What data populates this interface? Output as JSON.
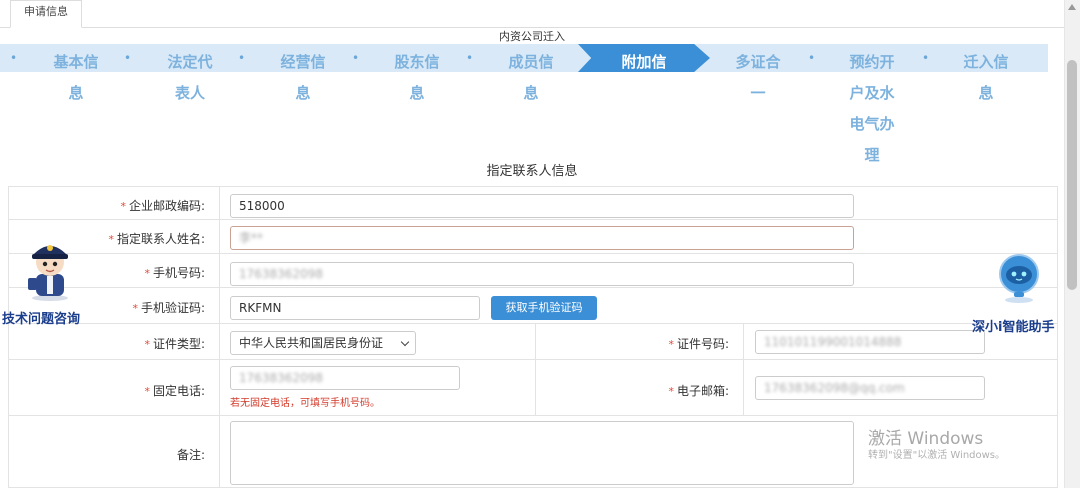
{
  "tab": {
    "label": "申请信息"
  },
  "wizard": {
    "title": "内资公司迁入",
    "steps": [
      {
        "lines": [
          "基本信",
          "息"
        ]
      },
      {
        "lines": [
          "法定代",
          "表人"
        ]
      },
      {
        "lines": [
          "经营信",
          "息"
        ]
      },
      {
        "lines": [
          "股东信",
          "息"
        ]
      },
      {
        "lines": [
          "成员信",
          "息"
        ]
      },
      {
        "lines": [
          "附加信",
          ""
        ]
      },
      {
        "lines": [
          "多证合",
          "一"
        ]
      },
      {
        "lines": [
          "预约开",
          "户及水",
          "电气办",
          "理"
        ]
      },
      {
        "lines": [
          "迁入信",
          "息"
        ]
      }
    ],
    "active_step": 5,
    "separator": "•"
  },
  "section": {
    "title": "指定联系人信息"
  },
  "form": {
    "required_mark": "*",
    "postal_code": {
      "label": "企业邮政编码:",
      "value": "518000"
    },
    "contact_name": {
      "label": "指定联系人姓名:",
      "value": "李**"
    },
    "mobile": {
      "label": "手机号码:",
      "value": "17638362098"
    },
    "sms_code": {
      "label": "手机验证码:",
      "value": "RKFMN",
      "button": "获取手机验证码"
    },
    "id_type": {
      "label": "证件类型:",
      "value": "中华人民共和国居民身份证"
    },
    "id_number": {
      "label": "证件号码:",
      "value": "110101199001014888"
    },
    "landline": {
      "label": "固定电话:",
      "value": "17638362098",
      "hint": "若无固定电话，可填写手机号码。"
    },
    "email": {
      "label": "电子邮箱:",
      "value": "17638362098@qq.com"
    },
    "remark": {
      "label": "备注:",
      "value": ""
    }
  },
  "helpers": {
    "left_label": "技术问题咨询",
    "right_label": "深小i智能助手"
  },
  "watermark": {
    "line1": "激活 Windows",
    "line2": "转到\"设置\"以激活 Windows。"
  },
  "colors": {
    "accent": "#3b8fd6",
    "step_bg": "#d9e9f7",
    "required": "#e04a3a"
  }
}
